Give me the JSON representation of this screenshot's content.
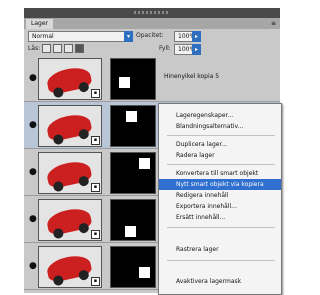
{
  "panel": {
    "tab_label": "Lager",
    "tab_menu_icon": "panel-menu-icon",
    "blend_mode": "Normal",
    "opacity_label": "Opacitet:",
    "opacity_value": "100%",
    "lock_label": "Lås:",
    "fill_label": "Fyll:",
    "fill_value": "100%"
  },
  "layers": [
    {
      "name": "Hinenyikel kopia 5",
      "selected": false
    },
    {
      "name": "",
      "selected": true
    },
    {
      "name": "",
      "selected": false
    },
    {
      "name": "",
      "selected": false
    },
    {
      "name": "",
      "selected": false
    }
  ],
  "context_menu": {
    "groups": [
      [
        "Lageregenskaper...",
        "Blandningsalternativ..."
      ],
      [
        "Duplicera lager...",
        "Radera lager"
      ],
      [
        "Konvertera till smart objekt",
        "Nytt smart objekt via kopiera",
        "Redigera innehåll",
        "Exportera innehåll...",
        "Ersätt innehåll..."
      ],
      [
        "Rastrera lager"
      ],
      [
        "Avaktivera lagermask"
      ]
    ],
    "highlighted": "Nytt smart objekt via kopiera"
  },
  "colors": {
    "highlight": "#2f6fd0",
    "panel_bg": "#c9c9c9"
  }
}
